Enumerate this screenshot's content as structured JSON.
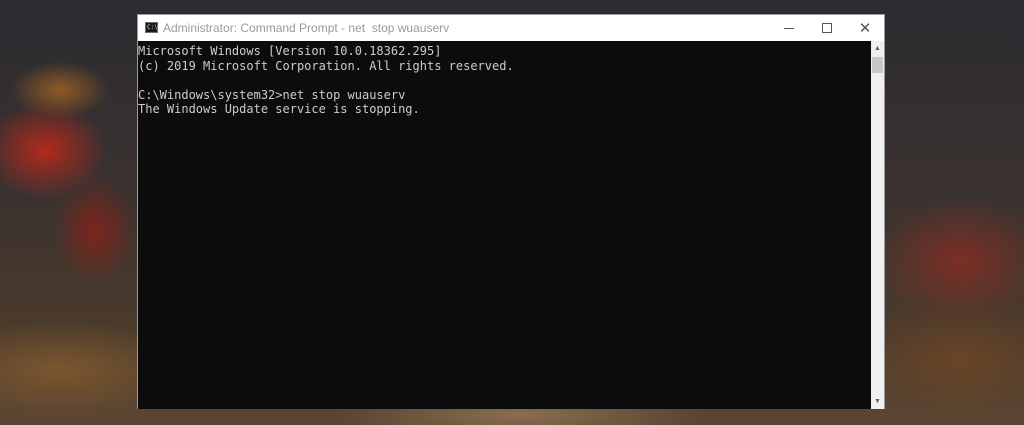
{
  "window": {
    "title": "Administrator: Command Prompt - net  stop wuauserv",
    "app_icon_text": "C:\\"
  },
  "controls": {
    "minimize_icon": "minimize-icon",
    "maximize_icon": "maximize-icon",
    "close_icon": "close-icon",
    "close_glyph": "✕"
  },
  "console": {
    "background": "#0c0c0c",
    "foreground": "#cccccc",
    "lines": [
      "Microsoft Windows [Version 10.0.18362.295]",
      "(c) 2019 Microsoft Corporation. All rights reserved.",
      "",
      "C:\\Windows\\system32>net stop wuauserv",
      "The Windows Update service is stopping."
    ]
  },
  "scrollbar": {
    "up_glyph": "▲",
    "down_glyph": "▼"
  }
}
